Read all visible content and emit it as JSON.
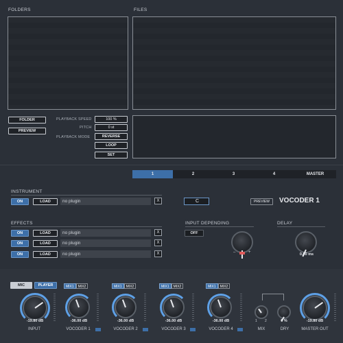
{
  "browser": {
    "folders_label": "FOLDERS",
    "files_label": "FILES"
  },
  "playback": {
    "folder_button": "FOLDER",
    "preview_button": "PREVIEW",
    "speed_label": "PLAYBACK SPEED",
    "speed_value": "100 %",
    "pitch_label": "PITCH",
    "pitch_value": "0 st",
    "mode_label": "PLAYBACK  MODE",
    "reverse_button": "REVERSE",
    "loop_button": "LOOP",
    "set_button": "SET"
  },
  "tabs": [
    "1",
    "2",
    "3",
    "4",
    "MASTER"
  ],
  "instrument": {
    "section_label": "INSTRUMENT",
    "on_label": "ON",
    "load_label": "LOAD",
    "plugin": "no plugin",
    "x_label": "X",
    "key_value": "C",
    "preview_label": "PREVIEW",
    "title": "VOCODER 1"
  },
  "effects": {
    "section_label": "EFFECTS",
    "slots": [
      {
        "on": "ON",
        "load": "LOAD",
        "plugin": "no plugin",
        "x": "X"
      },
      {
        "on": "ON",
        "load": "LOAD",
        "plugin": "no plugin",
        "x": "X"
      },
      {
        "on": "ON",
        "load": "LOAD",
        "plugin": "no plugin",
        "x": "X"
      }
    ]
  },
  "input_depending": {
    "label": "INPUT DEPENDING",
    "off_button": "OFF",
    "minus": "–",
    "plus": "+"
  },
  "delay": {
    "label": "DELAY",
    "value": "0.00 ms"
  },
  "mixer": {
    "mic_label": "MIC",
    "player_label": "PLAYER",
    "input": {
      "value": "-19.80 dB",
      "label": "INPUT"
    },
    "vocoders": [
      {
        "value": "-36.00 dB",
        "label": "VOCODER 1",
        "mix1": "MIX1",
        "mix2": "MIX2"
      },
      {
        "value": "-36.00 dB",
        "label": "VOCODER 2",
        "mix1": "MIX1",
        "mix2": "MIX2"
      },
      {
        "value": "-36.00 dB",
        "label": "VOCODER 3",
        "mix1": "MIX1",
        "mix2": "MIX2"
      },
      {
        "value": "-36.00 dB",
        "label": "VOCODER 4",
        "mix1": "MIX1",
        "mix2": "MIX2"
      }
    ],
    "mix": {
      "label": "MIX",
      "left": "1",
      "right": "2"
    },
    "dry": {
      "label": "DRY",
      "value": "0 %"
    },
    "master": {
      "value": "-19.80 dB",
      "label": "MASTER OUT"
    }
  },
  "colors": {
    "accent": "#3d6fa8",
    "background": "#2b3038",
    "knob_ring": "#5ea0e6"
  }
}
